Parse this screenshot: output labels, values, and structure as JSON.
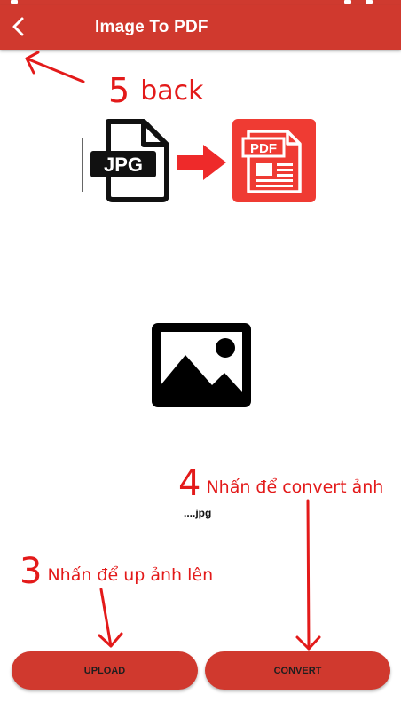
{
  "appbar": {
    "title": "Image To PDF",
    "back_icon": "chevron-left-icon"
  },
  "hero": {
    "from_label": "JPG",
    "to_label": "PDF",
    "arrow_icon": "right-arrow-icon"
  },
  "preview": {
    "icon": "image-placeholder-icon",
    "file_name": "....jpg"
  },
  "buttons": {
    "upload": "UPLOAD",
    "convert": "CONVERT"
  },
  "annotations": {
    "back": {
      "number": "5",
      "text": "back"
    },
    "upload": {
      "number": "3",
      "text": "Nhấn để up ảnh lên"
    },
    "convert": {
      "number": "4",
      "text": "Nhấn để convert ảnh"
    }
  },
  "colors": {
    "brand_red": "#d0392e",
    "pdf_red": "#ef3b33",
    "annotation_red": "#e31a1a"
  }
}
